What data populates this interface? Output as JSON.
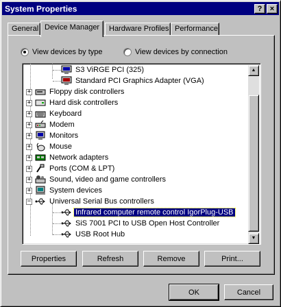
{
  "window": {
    "title": "System Properties",
    "help_label": "?",
    "close_label": "×"
  },
  "tabs": [
    {
      "label": "General",
      "active": false
    },
    {
      "label": "Device Manager",
      "active": true
    },
    {
      "label": "Hardware Profiles",
      "active": false
    },
    {
      "label": "Performance",
      "active": false
    }
  ],
  "view_options": {
    "by_type": {
      "label": "View devices by type",
      "checked": true
    },
    "by_connection": {
      "label": "View devices by connection",
      "checked": false
    }
  },
  "tree": {
    "items": [
      {
        "label": "S3 ViRGE PCI (325)",
        "level": 2,
        "icon": "display-adapter-icon"
      },
      {
        "label": "Standard PCI Graphics Adapter (VGA)",
        "level": 2,
        "icon": "display-adapter-warning-icon"
      },
      {
        "label": "Floppy disk controllers",
        "level": 1,
        "icon": "floppy-controller-icon",
        "expander": "+"
      },
      {
        "label": "Hard disk controllers",
        "level": 1,
        "icon": "hard-disk-controller-icon",
        "expander": "+"
      },
      {
        "label": "Keyboard",
        "level": 1,
        "icon": "keyboard-icon",
        "expander": "+"
      },
      {
        "label": "Modem",
        "level": 1,
        "icon": "modem-icon",
        "expander": "+"
      },
      {
        "label": "Monitors",
        "level": 1,
        "icon": "monitor-icon",
        "expander": "+"
      },
      {
        "label": "Mouse",
        "level": 1,
        "icon": "mouse-icon",
        "expander": "+"
      },
      {
        "label": "Network adapters",
        "level": 1,
        "icon": "network-adapter-icon",
        "expander": "+"
      },
      {
        "label": "Ports (COM & LPT)",
        "level": 1,
        "icon": "port-icon",
        "expander": "+"
      },
      {
        "label": "Sound, video and game controllers",
        "level": 1,
        "icon": "sound-controller-icon",
        "expander": "+"
      },
      {
        "label": "System devices",
        "level": 1,
        "icon": "system-device-icon",
        "expander": "+"
      },
      {
        "label": "Universal Serial Bus controllers",
        "level": 1,
        "icon": "usb-icon",
        "expander": "−"
      },
      {
        "label": "Infrared computer remote control IgorPlug-USB",
        "level": 2,
        "icon": "usb-icon",
        "selected": true
      },
      {
        "label": "SiS 7001 PCI to USB Open Host Controller",
        "level": 2,
        "icon": "usb-icon"
      },
      {
        "label": "USB Root Hub",
        "level": 2,
        "icon": "usb-icon"
      }
    ],
    "scroll_position": 0.92
  },
  "actions": {
    "properties": "Properties",
    "refresh": "Refresh",
    "remove": "Remove",
    "print": "Print..."
  },
  "footer": {
    "ok": "OK",
    "cancel": "Cancel"
  }
}
